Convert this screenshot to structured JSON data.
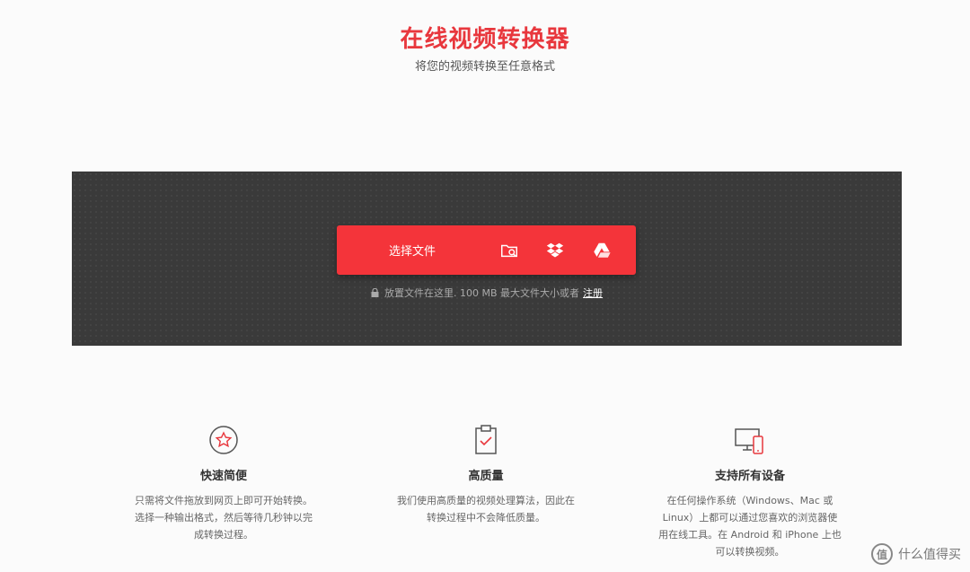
{
  "header": {
    "title": "在线视频转换器",
    "subtitle": "将您的视频转换至任意格式"
  },
  "uploader": {
    "choose_label": "选择文件",
    "icons": [
      "folder-search-icon",
      "dropbox-icon",
      "google-drive-icon"
    ],
    "hint_text": "放置文件在这里. 100 MB 最大文件大小或者",
    "register_link": "注册"
  },
  "features": [
    {
      "icon": "star-circle-icon",
      "title": "快速简便",
      "desc": "只需将文件拖放到网页上即可开始转换。选择一种输出格式，然后等待几秒钟以完成转换过程。"
    },
    {
      "icon": "clipboard-check-icon",
      "title": "高质量",
      "desc": "我们使用高质量的视频处理算法，因此在转换过程中不会降低质量。"
    },
    {
      "icon": "devices-icon",
      "title": "支持所有设备",
      "desc": "在任何操作系统（Windows、Mac 或 Linux）上都可以通过您喜欢的浏览器使用在线工具。在 Android 和 iPhone 上也可以转换视频。"
    }
  ],
  "watermark": {
    "text": "什么值得买",
    "logo_glyph": "值"
  },
  "colors": {
    "accent": "#f4343a",
    "title": "#e8373d",
    "dropzone": "#3a3a3a"
  }
}
